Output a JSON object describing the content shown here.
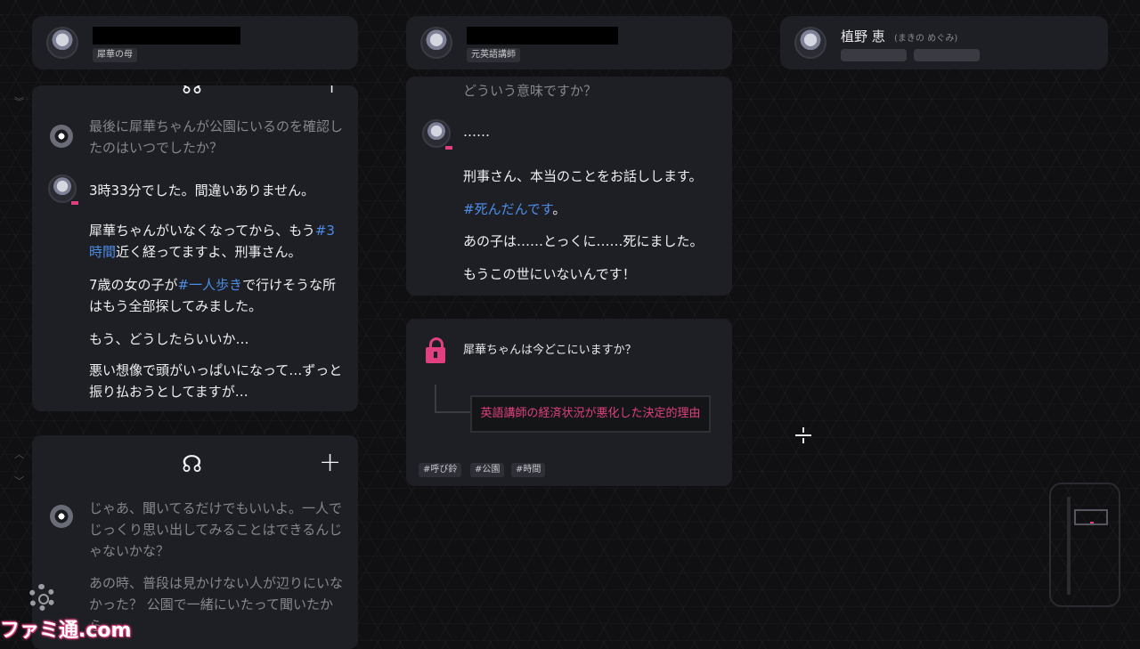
{
  "header_left": {
    "tag": "犀華の母"
  },
  "header_mid": {
    "tag": "元英語講師"
  },
  "header_right": {
    "name": "植野 恵",
    "furigana": "(まきの めぐみ)"
  },
  "left_panel": {
    "question": "最後に犀華ちゃんが公園にいるのを確認したのはいつでしたか？",
    "line1": "3時33分でした。間違いありません。",
    "line2a": "犀華ちゃんがいなくなってから、もう",
    "line2_hash": "#3時間",
    "line2b": "近く経ってますよ、刑事さん。",
    "line3a": "7歳の女の子が",
    "line3_hash": "#一人歩き",
    "line3b": "で行けそうな所はもう全部探してみました。",
    "line4": "もう、どうしたらいいか…",
    "line5": "悪い想像で頭がいっぱいになって…ずっと振り払おうとしてますが…"
  },
  "left_panel2": {
    "msg1": "じゃあ、聞いてるだけでもいいよ。一人でじっくり思い出してみることはできるんじゃないかな？",
    "msg2": "あの時、普段は見かけない人が辺りにいなかった？ 公園で一緒にいたって聞いたから。"
  },
  "mid_panel": {
    "top_partial": "どういう意味ですか？",
    "ellipsis": "……",
    "line1": "刑事さん、本当のことをお話しします。",
    "line2_hash": "#死んだんです",
    "line2b": "。",
    "line3": "あの子は……とっくに……死にました。",
    "line4": "もうこの世にいないんです！"
  },
  "question_panel": {
    "question": "犀華ちゃんは今どこにいますか？",
    "option": "英語講師の経済状況が悪化した決定的理由",
    "tags": [
      "#呼び鈴",
      "#公園",
      "#時間"
    ]
  },
  "watermark": "ファミ通.com",
  "colors": {
    "accent_pink": "#e0407f",
    "hashtag_blue": "#4d8de8",
    "panel_bg": "#1e1f24"
  },
  "icons": [
    "speech-bubble-icon",
    "plus-icon",
    "lock-icon",
    "gear-icon",
    "police-badge-icon"
  ]
}
